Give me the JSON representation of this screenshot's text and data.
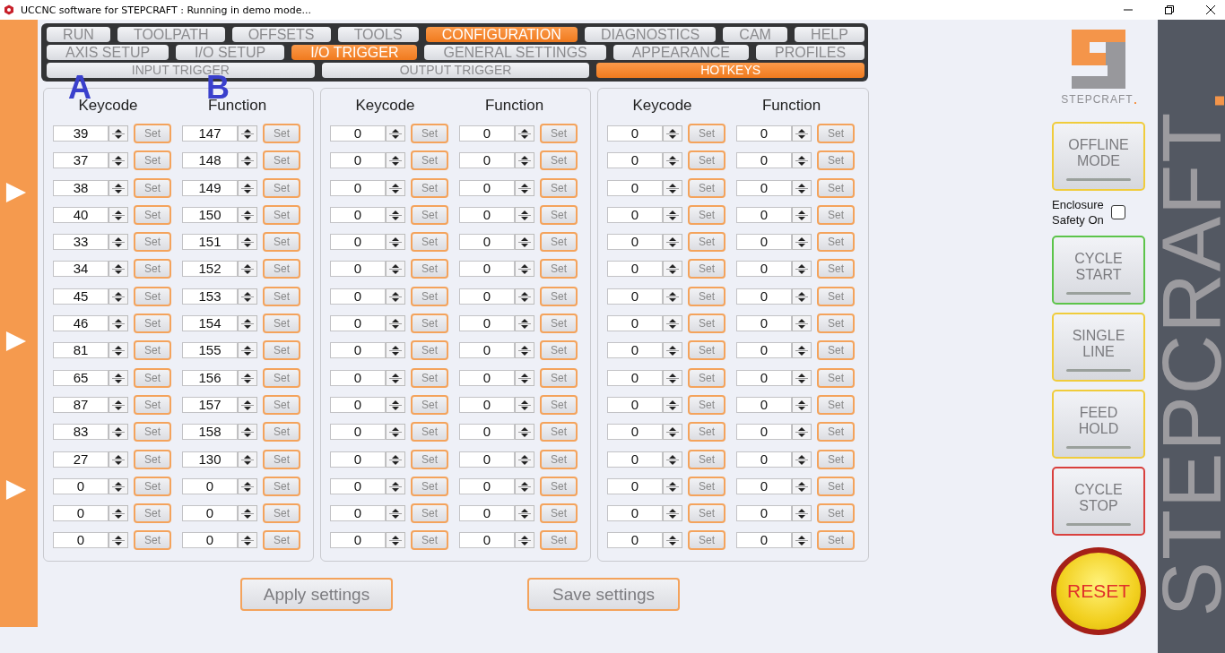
{
  "window": {
    "title": "UCCNC software for STEPCRAFT : Running in demo mode..."
  },
  "tab_rows": [
    [
      {
        "label": "RUN",
        "selected": false
      },
      {
        "label": "TOOLPATH",
        "selected": false
      },
      {
        "label": "OFFSETS",
        "selected": false
      },
      {
        "label": "TOOLS",
        "selected": false
      },
      {
        "label": "CONFIGURATION",
        "selected": true
      },
      {
        "label": "DIAGNOSTICS",
        "selected": false
      },
      {
        "label": "CAM",
        "selected": false
      },
      {
        "label": "HELP",
        "selected": false
      }
    ],
    [
      {
        "label": "AXIS SETUP",
        "selected": false
      },
      {
        "label": "I/O SETUP",
        "selected": false
      },
      {
        "label": "I/O  TRIGGER",
        "selected": true
      },
      {
        "label": "GENERAL SETTINGS",
        "selected": false
      },
      {
        "label": "APPEARANCE",
        "selected": false
      },
      {
        "label": "PROFILES",
        "selected": false
      }
    ],
    [
      {
        "label": "INPUT TRIGGER",
        "selected": false
      },
      {
        "label": "OUTPUT TRIGGER",
        "selected": false
      },
      {
        "label": "HOTKEYS",
        "selected": true
      }
    ]
  ],
  "annotations": [
    "A",
    "B"
  ],
  "panels": [
    {
      "headers": [
        "Keycode",
        "Function"
      ],
      "rows": [
        {
          "keycode": "39",
          "keycode_set": "Set",
          "function": "147",
          "function_set": "Set"
        },
        {
          "keycode": "37",
          "keycode_set": "Set",
          "function": "148",
          "function_set": "Set"
        },
        {
          "keycode": "38",
          "keycode_set": "Set",
          "function": "149",
          "function_set": "Set"
        },
        {
          "keycode": "40",
          "keycode_set": "Set",
          "function": "150",
          "function_set": "Set"
        },
        {
          "keycode": "33",
          "keycode_set": "Set",
          "function": "151",
          "function_set": "Set"
        },
        {
          "keycode": "34",
          "keycode_set": "Set",
          "function": "152",
          "function_set": "Set"
        },
        {
          "keycode": "45",
          "keycode_set": "Set",
          "function": "153",
          "function_set": "Set"
        },
        {
          "keycode": "46",
          "keycode_set": "Set",
          "function": "154",
          "function_set": "Set"
        },
        {
          "keycode": "81",
          "keycode_set": "Set",
          "function": "155",
          "function_set": "Set"
        },
        {
          "keycode": "65",
          "keycode_set": "Set",
          "function": "156",
          "function_set": "Set"
        },
        {
          "keycode": "87",
          "keycode_set": "Set",
          "function": "157",
          "function_set": "Set"
        },
        {
          "keycode": "83",
          "keycode_set": "Set",
          "function": "158",
          "function_set": "Set"
        },
        {
          "keycode": "27",
          "keycode_set": "Set",
          "function": "130",
          "function_set": "Set"
        },
        {
          "keycode": "0",
          "keycode_set": "Set",
          "function": "0",
          "function_set": "Set"
        },
        {
          "keycode": "0",
          "keycode_set": "Set",
          "function": "0",
          "function_set": "Set"
        },
        {
          "keycode": "0",
          "keycode_set": "Set",
          "function": "0",
          "function_set": "Set"
        }
      ]
    },
    {
      "headers": [
        "Keycode",
        "Function"
      ],
      "rows": [
        {
          "keycode": "0",
          "keycode_set": "Set",
          "function": "0",
          "function_set": "Set"
        },
        {
          "keycode": "0",
          "keycode_set": "Set",
          "function": "0",
          "function_set": "Set"
        },
        {
          "keycode": "0",
          "keycode_set": "Set",
          "function": "0",
          "function_set": "Set"
        },
        {
          "keycode": "0",
          "keycode_set": "Set",
          "function": "0",
          "function_set": "Set"
        },
        {
          "keycode": "0",
          "keycode_set": "Set",
          "function": "0",
          "function_set": "Set"
        },
        {
          "keycode": "0",
          "keycode_set": "Set",
          "function": "0",
          "function_set": "Set"
        },
        {
          "keycode": "0",
          "keycode_set": "Set",
          "function": "0",
          "function_set": "Set"
        },
        {
          "keycode": "0",
          "keycode_set": "Set",
          "function": "0",
          "function_set": "Set"
        },
        {
          "keycode": "0",
          "keycode_set": "Set",
          "function": "0",
          "function_set": "Set"
        },
        {
          "keycode": "0",
          "keycode_set": "Set",
          "function": "0",
          "function_set": "Set"
        },
        {
          "keycode": "0",
          "keycode_set": "Set",
          "function": "0",
          "function_set": "Set"
        },
        {
          "keycode": "0",
          "keycode_set": "Set",
          "function": "0",
          "function_set": "Set"
        },
        {
          "keycode": "0",
          "keycode_set": "Set",
          "function": "0",
          "function_set": "Set"
        },
        {
          "keycode": "0",
          "keycode_set": "Set",
          "function": "0",
          "function_set": "Set"
        },
        {
          "keycode": "0",
          "keycode_set": "Set",
          "function": "0",
          "function_set": "Set"
        },
        {
          "keycode": "0",
          "keycode_set": "Set",
          "function": "0",
          "function_set": "Set"
        }
      ]
    },
    {
      "headers": [
        "Keycode",
        "Function"
      ],
      "rows": [
        {
          "keycode": "0",
          "keycode_set": "Set",
          "function": "0",
          "function_set": "Set"
        },
        {
          "keycode": "0",
          "keycode_set": "Set",
          "function": "0",
          "function_set": "Set"
        },
        {
          "keycode": "0",
          "keycode_set": "Set",
          "function": "0",
          "function_set": "Set"
        },
        {
          "keycode": "0",
          "keycode_set": "Set",
          "function": "0",
          "function_set": "Set"
        },
        {
          "keycode": "0",
          "keycode_set": "Set",
          "function": "0",
          "function_set": "Set"
        },
        {
          "keycode": "0",
          "keycode_set": "Set",
          "function": "0",
          "function_set": "Set"
        },
        {
          "keycode": "0",
          "keycode_set": "Set",
          "function": "0",
          "function_set": "Set"
        },
        {
          "keycode": "0",
          "keycode_set": "Set",
          "function": "0",
          "function_set": "Set"
        },
        {
          "keycode": "0",
          "keycode_set": "Set",
          "function": "0",
          "function_set": "Set"
        },
        {
          "keycode": "0",
          "keycode_set": "Set",
          "function": "0",
          "function_set": "Set"
        },
        {
          "keycode": "0",
          "keycode_set": "Set",
          "function": "0",
          "function_set": "Set"
        },
        {
          "keycode": "0",
          "keycode_set": "Set",
          "function": "0",
          "function_set": "Set"
        },
        {
          "keycode": "0",
          "keycode_set": "Set",
          "function": "0",
          "function_set": "Set"
        },
        {
          "keycode": "0",
          "keycode_set": "Set",
          "function": "0",
          "function_set": "Set"
        },
        {
          "keycode": "0",
          "keycode_set": "Set",
          "function": "0",
          "function_set": "Set"
        },
        {
          "keycode": "0",
          "keycode_set": "Set",
          "function": "0",
          "function_set": "Set"
        }
      ]
    }
  ],
  "actions": [
    "Apply settings",
    "Save settings"
  ],
  "logo_text": "STEPCRAFT",
  "side_buttons": [
    {
      "lines": [
        "OFFLINE",
        "MODE"
      ],
      "color": "#f0cc3c"
    },
    {
      "lines": [
        "CYCLE",
        "START"
      ],
      "color": "#5cc44a"
    },
    {
      "lines": [
        "SINGLE",
        "LINE"
      ],
      "color": "#f0cc3c"
    },
    {
      "lines": [
        "FEED",
        "HOLD"
      ],
      "color": "#f0cc3c"
    },
    {
      "lines": [
        "CYCLE",
        "STOP"
      ],
      "color": "#d9403e"
    }
  ],
  "enclosure": {
    "label": [
      "Enclosure",
      "Safety On"
    ],
    "checked": false
  },
  "reset_button": "RESET",
  "brand_banner": "STEPCRAFT"
}
